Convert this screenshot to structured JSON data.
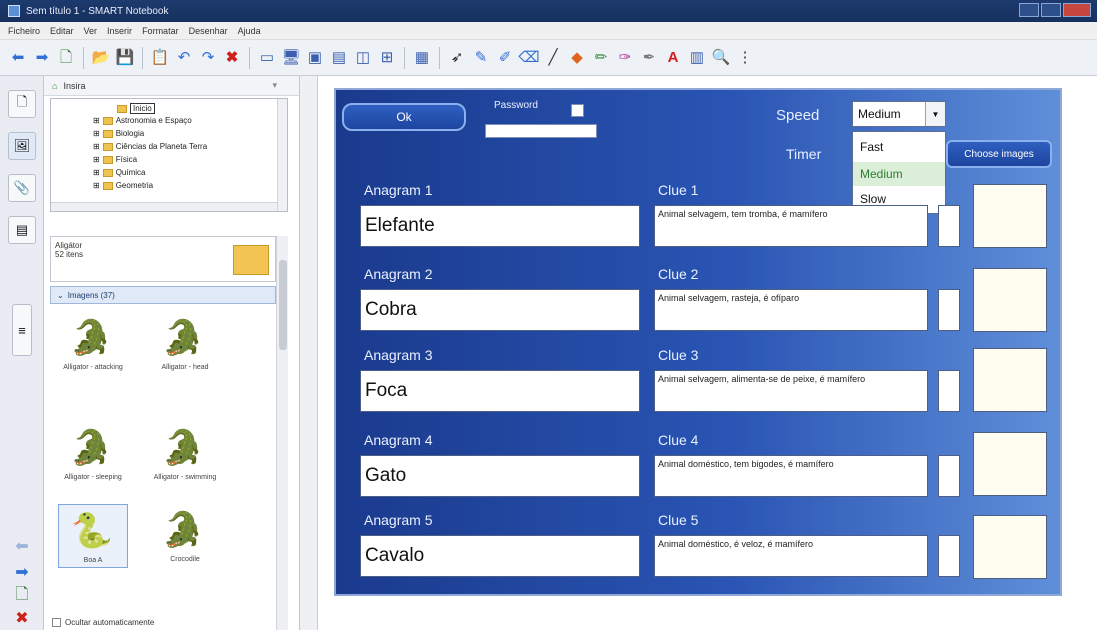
{
  "window": {
    "title": "Sem título 1 - SMART Notebook"
  },
  "menubar": {
    "items": [
      "Ficheiro",
      "Editar",
      "Ver",
      "Inserir",
      "Formatar",
      "Desenhar",
      "Ajuda"
    ]
  },
  "toolbar": {
    "icons": [
      "back-arrow-icon",
      "forward-arrow-icon",
      "add-page-icon",
      "open-folder-icon",
      "save-icon",
      "paste-icon",
      "undo-icon",
      "redo-icon",
      "delete-icon",
      "screen-shade-icon",
      "display-icon",
      "screen-capture-icon",
      "table-icon",
      "select-icon",
      "pen-icon",
      "creative-pen-icon",
      "eraser-icon",
      "line-icon",
      "shapes-icon",
      "magic-pen-icon",
      "fill-icon",
      "text-icon",
      "properties-icon",
      "more-icon"
    ]
  },
  "gallery": {
    "search_placeholder": "Insira",
    "tree": {
      "selected": "Inicio",
      "items": [
        "Astronomia e Espaço",
        "Biologia",
        "Ciências da Planeta Terra",
        "Física",
        "Química",
        "Geometria"
      ]
    },
    "info": {
      "title": "Aligátor",
      "subtitle": "52 itens"
    },
    "category": "Imagens (37)",
    "thumbs": [
      {
        "caption": "Alligator - attacking",
        "icon": "alligator-icon"
      },
      {
        "caption": "Alligator - head",
        "icon": "alligator-head-icon"
      },
      {
        "caption": "Alligator - sleeping",
        "icon": "alligator-sleeping-icon"
      },
      {
        "caption": "Alligator - swimming",
        "icon": "alligator-swimming-icon"
      },
      {
        "caption": "Boa A",
        "icon": "snake-icon"
      },
      {
        "caption": "Crocodile",
        "icon": "crocodile-icon"
      }
    ],
    "footer_checkbox": "Ocultar automaticamente"
  },
  "widget": {
    "ok_label": "Ok",
    "password_label": "Password",
    "speed_label": "Speed",
    "speed_selected": "Medium",
    "speed_options": [
      "Fast",
      "Medium",
      "Slow"
    ],
    "timer_label": "Timer",
    "choose_images_label": "Choose images",
    "rows": [
      {
        "anagram_label": "Anagram 1",
        "anagram": "Elefante",
        "clue_label": "Clue 1",
        "clue": "Animal selvagem, tem tromba, é mamífero"
      },
      {
        "anagram_label": "Anagram 2",
        "anagram": "Cobra",
        "clue_label": "Clue 2",
        "clue": "Animal selvagem, rasteja, é ofíparo"
      },
      {
        "anagram_label": "Anagram 3",
        "anagram": "Foca",
        "clue_label": "Clue 3",
        "clue": "Animal selvagem, alimenta-se de peixe, é mamífero"
      },
      {
        "anagram_label": "Anagram 4",
        "anagram": "Gato",
        "clue_label": "Clue 4",
        "clue": "Animal doméstico, tem bigodes, é mamífero"
      },
      {
        "anagram_label": "Anagram 5",
        "anagram": "Cavalo",
        "clue_label": "Clue 5",
        "clue": "Animal doméstico, é veloz, é mamífero"
      }
    ]
  },
  "colors": {
    "widget_blue": "#1a3a8d",
    "widget_light_blue": "#5f8fd9",
    "selected_option_green": "#2f7d34"
  }
}
